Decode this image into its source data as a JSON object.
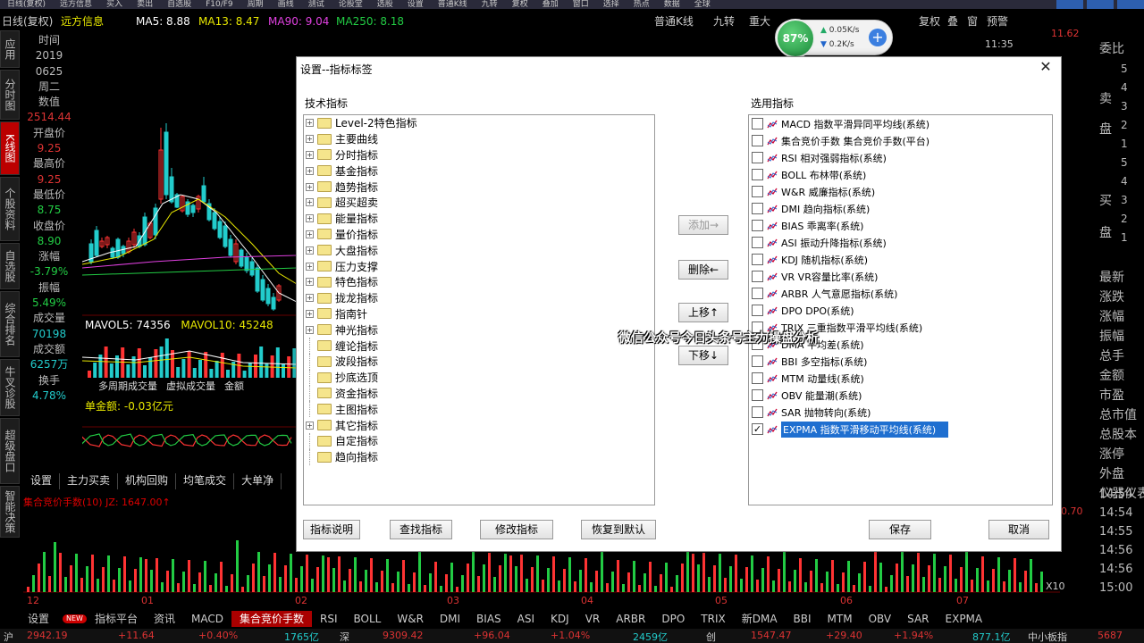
{
  "topbar": {
    "items": [
      "日线(复权)",
      "远方信息",
      "买入",
      "卖出",
      "自选股",
      "F10/F9",
      "周期",
      "画线",
      "测试",
      "论股堂",
      "选股",
      "设置",
      "普通K线",
      "九转",
      "复权",
      "叠加",
      "窗口",
      "选择",
      "热点",
      "数据",
      "全球"
    ]
  },
  "infobar": {
    "period": "日线(复权)",
    "stock": "远方信息",
    "ma5": "MA5: 8.88",
    "ma13": "MA13: 8.47",
    "ma90": "MA90: 9.04",
    "ma250": "MA250: 8.18",
    "kline_type": "普通K线",
    "jiuzhuan": "九转",
    "chong": "重大",
    "fuquan": "复权",
    "diejia": "叠",
    "chuang": "窗",
    "yujing": "预警",
    "time": "11:35",
    "right_price": "11.62"
  },
  "network": {
    "percent": "87%",
    "up": "0.05K/s",
    "down": "0.2K/s",
    "plus": "+"
  },
  "left_tabs": [
    "应用",
    "分时图",
    "K线图",
    "个股资料",
    "自选股",
    "综合排名",
    "牛叉诊股",
    "超级盘口",
    "智能决策"
  ],
  "data_col": {
    "rows": [
      {
        "t": "时间",
        "c": "#bbbbbb"
      },
      {
        "t": "2019",
        "c": "#bbbbbb"
      },
      {
        "t": "0625",
        "c": "#bbbbbb"
      },
      {
        "t": "周二",
        "c": "#bbbbbb"
      },
      {
        "t": "数值",
        "c": "#bbbbbb"
      },
      {
        "t": "2514.44",
        "c": "#dd3333"
      },
      {
        "t": "开盘价",
        "c": "#bbbbbb"
      },
      {
        "t": "9.25",
        "c": "#dd3333"
      },
      {
        "t": "最高价",
        "c": "#bbbbbb"
      },
      {
        "t": "9.25",
        "c": "#dd3333"
      },
      {
        "t": "最低价",
        "c": "#bbbbbb"
      },
      {
        "t": "8.75",
        "c": "#22cc44"
      },
      {
        "t": "收盘价",
        "c": "#bbbbbb"
      },
      {
        "t": "8.90",
        "c": "#22cc44"
      },
      {
        "t": "涨幅",
        "c": "#bbbbbb"
      },
      {
        "t": "-3.79%",
        "c": "#22cc44"
      },
      {
        "t": "振幅",
        "c": "#bbbbbb"
      },
      {
        "t": "5.49%",
        "c": "#22cc44"
      },
      {
        "t": "成交量",
        "c": "#bbbbbb"
      },
      {
        "t": "70198",
        "c": "#22cccc"
      },
      {
        "t": "成交额",
        "c": "#bbbbbb"
      },
      {
        "t": "6257万",
        "c": "#22cccc"
      },
      {
        "t": "换手",
        "c": "#bbbbbb"
      },
      {
        "t": "4.78%",
        "c": "#22cccc"
      }
    ]
  },
  "volume": {
    "mavol5": "MAVOL5: 74356",
    "mavol10": "MAVOL10: 45248"
  },
  "subtabs1": [
    "多周期成交量",
    "虚拟成交量",
    "金额"
  ],
  "funds": "单金额: -0.03亿元",
  "subtabs2": [
    "设置",
    "主力买卖",
    "机构回购",
    "均笔成交",
    "大单净"
  ],
  "ind_legend": "集合竞价手数(10) JZ: 1647.00↑",
  "right_panel": {
    "labels": [
      "委比",
      "卖",
      "盘",
      "买",
      "盘",
      "最新",
      "涨跌",
      "涨幅",
      "振幅",
      "总手",
      "金额",
      "市盈",
      "总市值",
      "总股本",
      "涨停",
      "外盘",
      "仪器仪表"
    ],
    "nums": [
      "5",
      "4",
      "3",
      "2",
      "1",
      "5",
      "4",
      "3",
      "2",
      "1"
    ],
    "times": [
      "14:54",
      "14:54",
      "14:55",
      "14:56",
      "14:56",
      "15:00"
    ]
  },
  "x_axis": [
    "12",
    "01",
    "02",
    "03",
    "04",
    "05",
    "06",
    "07"
  ],
  "x_note": "X10",
  "price_labels": [
    "10.70"
  ],
  "dialog": {
    "title": "设置--指标标签",
    "close": "✕",
    "left_label": "技术指标",
    "right_label": "选用指标",
    "tree": [
      {
        "label": "Level-2特色指标",
        "expand": true
      },
      {
        "label": "主要曲线",
        "expand": true
      },
      {
        "label": "分时指标",
        "expand": true
      },
      {
        "label": "基金指标",
        "expand": true
      },
      {
        "label": "趋势指标",
        "expand": true
      },
      {
        "label": "超买超卖",
        "expand": true
      },
      {
        "label": "能量指标",
        "expand": true
      },
      {
        "label": "量价指标",
        "expand": true
      },
      {
        "label": "大盘指标",
        "expand": true
      },
      {
        "label": "压力支撑",
        "expand": true
      },
      {
        "label": "特色指标",
        "expand": true
      },
      {
        "label": "拢龙指标",
        "expand": true
      },
      {
        "label": "指南针",
        "expand": true
      },
      {
        "label": "神光指标",
        "expand": true
      },
      {
        "label": "缠论指标",
        "expand": false
      },
      {
        "label": "波段指标",
        "expand": false
      },
      {
        "label": "抄底选顶",
        "expand": false
      },
      {
        "label": "资金指标",
        "expand": false
      },
      {
        "label": "主图指标",
        "expand": false
      },
      {
        "label": "其它指标",
        "expand": true
      },
      {
        "label": "自定指标",
        "expand": false
      },
      {
        "label": "趋向指标",
        "expand": false
      }
    ],
    "middle_buttons": {
      "add": "添加→",
      "remove": "删除←",
      "up": "上移↑",
      "down": "下移↓"
    },
    "selected": [
      {
        "label": "MACD 指数平滑异同平均线(系统)",
        "checked": false
      },
      {
        "label": "集合竞价手数 集合竞价手数(平台)",
        "checked": false
      },
      {
        "label": "RSI 相对强弱指标(系统)",
        "checked": false
      },
      {
        "label": "BOLL 布林带(系统)",
        "checked": false
      },
      {
        "label": "W&R 威廉指标(系统)",
        "checked": false
      },
      {
        "label": "DMI 趋向指标(系统)",
        "checked": false
      },
      {
        "label": "BIAS 乖离率(系统)",
        "checked": false
      },
      {
        "label": "ASI 振动升降指标(系统)",
        "checked": false
      },
      {
        "label": "KDJ 随机指标(系统)",
        "checked": false
      },
      {
        "label": "VR VR容量比率(系统)",
        "checked": false
      },
      {
        "label": "ARBR 人气意愿指标(系统)",
        "checked": false
      },
      {
        "label": "DPO DPO(系统)",
        "checked": false
      },
      {
        "label": "TRIX 三重指数平滑平均线(系统)",
        "checked": false
      },
      {
        "label": "DMA 平均差(系统)",
        "checked": false
      },
      {
        "label": "BBI 多空指标(系统)",
        "checked": false
      },
      {
        "label": "MTM 动量线(系统)",
        "checked": false
      },
      {
        "label": "OBV 能量潮(系统)",
        "checked": false
      },
      {
        "label": "SAR 抛物转向(系统)",
        "checked": false
      },
      {
        "label": "EXPMA 指数平滑移动平均线(系统)",
        "checked": true,
        "selected": true
      }
    ],
    "bottom_buttons": {
      "explain": "指标说明",
      "find": "查找指标",
      "modify": "修改指标",
      "restore": "恢复到默认",
      "save": "保存",
      "cancel": "取消"
    }
  },
  "watermark": "微信公众号今日头条号主力操盘分析",
  "bottom_tabs": [
    "设置",
    "NEW",
    "指标平台",
    "资讯",
    "MACD",
    "集合竞价手数",
    "RSI",
    "BOLL",
    "W&R",
    "DMI",
    "BIAS",
    "ASI",
    "KDJ",
    "VR",
    "ARBR",
    "DPO",
    "TRIX",
    "新DMA",
    "BBI",
    "MTM",
    "OBV",
    "SAR",
    "EXPMA"
  ],
  "ticker": {
    "items": [
      {
        "t": "沪",
        "c": "#cccccc"
      },
      {
        "t": "2942.19",
        "c": "#dd3333"
      },
      {
        "t": "+11.64",
        "c": "#dd3333"
      },
      {
        "t": "+0.40%",
        "c": "#dd3333"
      },
      {
        "t": "1765亿",
        "c": "#22cccc"
      },
      {
        "t": "深",
        "c": "#cccccc"
      },
      {
        "t": "9309.42",
        "c": "#dd3333"
      },
      {
        "t": "+96.04",
        "c": "#dd3333"
      },
      {
        "t": "+1.04%",
        "c": "#dd3333"
      },
      {
        "t": "2459亿",
        "c": "#22cccc"
      },
      {
        "t": "创",
        "c": "#cccccc"
      },
      {
        "t": "1547.47",
        "c": "#dd3333"
      },
      {
        "t": "+29.40",
        "c": "#dd3333"
      },
      {
        "t": "+1.94%",
        "c": "#dd3333"
      },
      {
        "t": "877.1亿",
        "c": "#22cccc"
      },
      {
        "t": "中小板指",
        "c": "#cccccc"
      },
      {
        "t": "5687",
        "c": "#dd3333"
      }
    ]
  },
  "colors": {
    "up": "#dd3333",
    "down": "#22cccc",
    "ma5": "#ffffff",
    "ma13": "#e8e800",
    "ma90": "#e040e0",
    "ma250": "#22cc44",
    "selection": "#1f6fd0"
  }
}
